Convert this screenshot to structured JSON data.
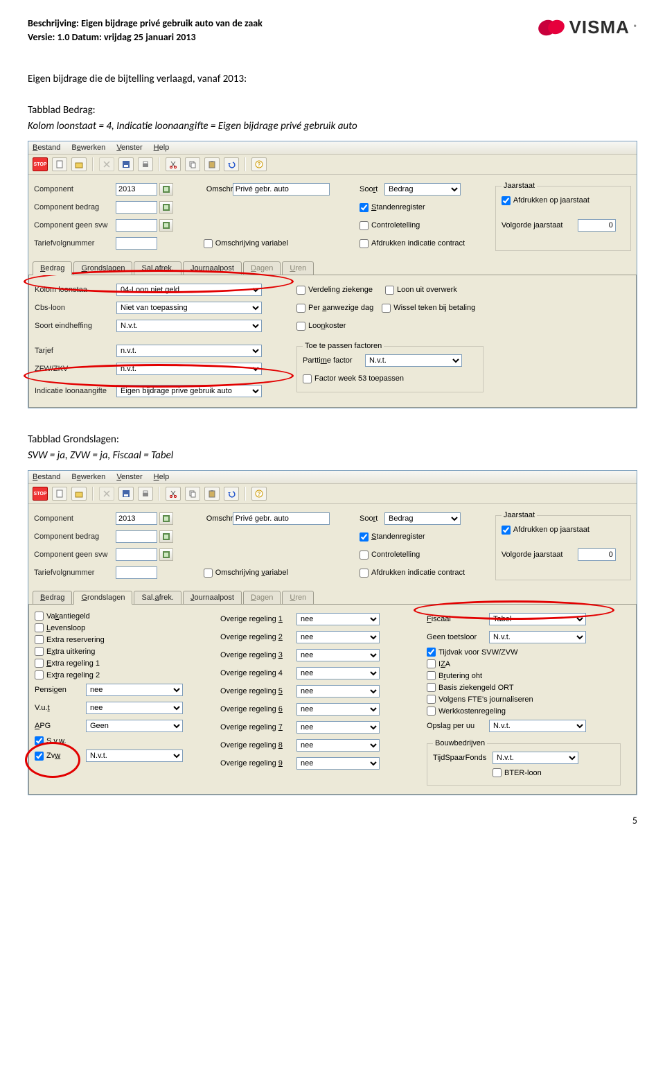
{
  "header": {
    "line1": "Beschrijving: Eigen bijdrage privé gebruik auto van de zaak",
    "line2": "Versie: 1.0 Datum: vrijdag 25 januari 2013"
  },
  "logo_text": "VISMA",
  "section1": {
    "title": "Eigen bijdrage die de bijtelling verlaagd, vanaf 2013:",
    "p1": "Tabblad Bedrag:",
    "p2": "Kolom loonstaat = 4, Indicatie loonaangifte = Eigen bijdrage privé gebruik auto"
  },
  "section2": {
    "p1": "Tabblad Grondslagen:",
    "p2": "SVW = ja, ZVW = ja, Fiscaal = Tabel"
  },
  "menu": {
    "bestand": "Bestand",
    "bewerken": "Bewerken",
    "venster": "Venster",
    "help": "Help"
  },
  "labels": {
    "component": "Component",
    "componentBedrag": "Component bedrag",
    "componentGeenSvw": "Component geen svw",
    "tariefvolgnummer": "Tariefvolgnummer",
    "omschr": "Omschr.",
    "soort": "Soort",
    "omschrVariabel": "Omschrijving variabel",
    "standenregister": "Standenregister",
    "controletelling": "Controletelling",
    "afdrukkenIndicatie": "Afdrukken indicatie contract",
    "jaarstaat": "Jaarstaat",
    "afdrukkenJaarstaat": "Afdrukken op jaarstaat",
    "volgordeJaarstaat": "Volgorde jaarstaat",
    "volgorde_value": "0",
    "kolomLoonstaat": "Kolom loonstaa",
    "cbsLoon": "Cbs-loon",
    "soortEindheffing": "Soort eindheffing",
    "tarief": "Tarief",
    "zfwZkv": "ZFW/ZKV",
    "indicatieLoon": "Indicatie loonaangifte",
    "verdelingZiekenge": "Verdeling ziekenge",
    "loonUitOverwerk": "Loon uit overwerk",
    "perAanwezigeDag": "Per aanwezige dag",
    "wisselTeken": "Wissel teken bij betaling",
    "loonkoster": "Loonkoster",
    "toeTePassen": "Toe te passen factoren",
    "parttimeFactor": "Parttime factor",
    "factorWeek53": "Factor week 53 toepassen",
    "vakantiegeld": "Vakantiegeld",
    "levensloop": "Levensloop",
    "extraReservering": "Extra reservering",
    "extraUitkering": "Extra uitkering",
    "extraRegeling1": "Extra regeling 1",
    "extraRegeling2": "Extra regeling 2",
    "pensioen": "Pensioen",
    "vut": "V.u.t",
    "apg": "APG",
    "svw": "S.v.w.",
    "zvw": "Zvw",
    "overigeRegeling": "Overige regeling",
    "fiscaal": "Fiscaal",
    "geenToetsloor": "Geen toetsloor",
    "tijdvakSvwZvw": "Tijdvak voor SVW/ZVW",
    "iza": "IZA",
    "bruteringOht": "Brutering oht",
    "basisZiekengeld": "Basis ziekengeld ORT",
    "volgensFte": "Volgens FTE's journaliseren",
    "werkkosten": "Werkkostenregeling",
    "opslagPerUu": "Opslag per uu",
    "bouwbedrijven": "Bouwbedrijven",
    "tijdSpaarFonds": "TijdSpaarFonds",
    "bterLoon": "BTER-loon"
  },
  "values": {
    "component": "2013",
    "omschr": "Privé gebr. auto",
    "soort": "Bedrag",
    "kolomLoonstaat": "04-Loon niet geld",
    "cbsLoon": "Niet van toepassing",
    "soortEindheffing": "N.v.t.",
    "tarief": "n.v.t.",
    "zfwZkv": "n.v.t.",
    "indicatieLoon": "Eigen bijdrage prive gebruik auto",
    "parttimeFactor": "N.v.t.",
    "pensioen": "nee",
    "vut": "nee",
    "apg": "Geen",
    "zvw": "N.v.t.",
    "overige": "nee",
    "fiscaal": "Tabel",
    "geenToetsloor": "N.v.t.",
    "opslag": "N.v.t.",
    "tijdSpaar": "N.v.t."
  },
  "tabs": {
    "bedrag": "Bedrag",
    "grondslagen": "Grondslagen",
    "salafrek": "Sal.afrek.",
    "journaalpost": "Journaalpost",
    "dagen": "Dagen",
    "uren": "Uren"
  },
  "page_number": "5"
}
